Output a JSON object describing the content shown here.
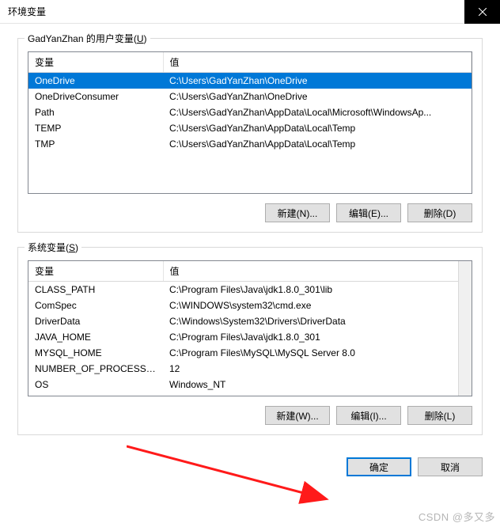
{
  "titlebar": {
    "title": "环境变量"
  },
  "user_section": {
    "label_prefix": "GadYanZhan 的用户变量(",
    "label_hotkey": "U",
    "label_suffix": ")",
    "headers": {
      "var": "变量",
      "val": "值"
    },
    "rows": [
      {
        "var": "OneDrive",
        "val": "C:\\Users\\GadYanZhan\\OneDrive",
        "selected": true
      },
      {
        "var": "OneDriveConsumer",
        "val": "C:\\Users\\GadYanZhan\\OneDrive"
      },
      {
        "var": "Path",
        "val": "C:\\Users\\GadYanZhan\\AppData\\Local\\Microsoft\\WindowsAp..."
      },
      {
        "var": "TEMP",
        "val": "C:\\Users\\GadYanZhan\\AppData\\Local\\Temp"
      },
      {
        "var": "TMP",
        "val": "C:\\Users\\GadYanZhan\\AppData\\Local\\Temp"
      }
    ],
    "buttons": {
      "new": "新建(N)...",
      "edit": "编辑(E)...",
      "del": "删除(D)"
    }
  },
  "system_section": {
    "label_prefix": "系统变量(",
    "label_hotkey": "S",
    "label_suffix": ")",
    "headers": {
      "var": "变量",
      "val": "值"
    },
    "rows": [
      {
        "var": "CLASS_PATH",
        "val": "C:\\Program Files\\Java\\jdk1.8.0_301\\lib"
      },
      {
        "var": "ComSpec",
        "val": "C:\\WINDOWS\\system32\\cmd.exe"
      },
      {
        "var": "DriverData",
        "val": "C:\\Windows\\System32\\Drivers\\DriverData"
      },
      {
        "var": "JAVA_HOME",
        "val": "C:\\Program Files\\Java\\jdk1.8.0_301"
      },
      {
        "var": "MYSQL_HOME",
        "val": "C:\\Program Files\\MySQL\\MySQL Server 8.0"
      },
      {
        "var": "NUMBER_OF_PROCESSORS",
        "val": "12"
      },
      {
        "var": "OS",
        "val": "Windows_NT"
      }
    ],
    "buttons": {
      "new": "新建(W)...",
      "edit": "编辑(I)...",
      "del": "删除(L)"
    }
  },
  "dialog_buttons": {
    "ok": "确定",
    "cancel": "取消"
  },
  "watermark": "CSDN @多又多"
}
